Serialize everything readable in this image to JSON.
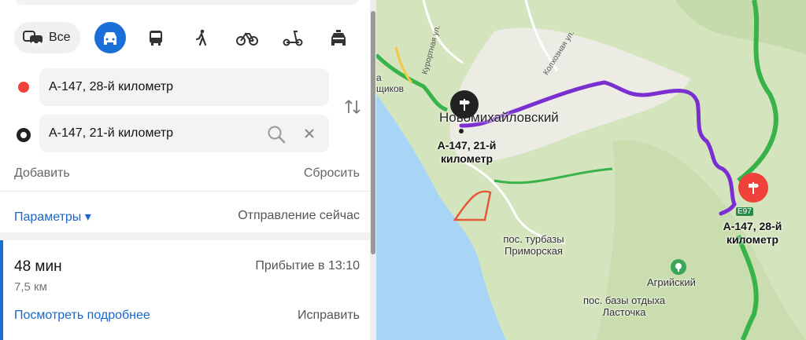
{
  "modes": {
    "all_label": "Все",
    "items": [
      {
        "name": "car",
        "active": true
      },
      {
        "name": "bus"
      },
      {
        "name": "walk"
      },
      {
        "name": "bicycle"
      },
      {
        "name": "scooter"
      },
      {
        "name": "taxi"
      }
    ]
  },
  "route_points": {
    "from": "А-147, 28-й километр",
    "to": "А-147, 21-й километр"
  },
  "actions": {
    "add": "Добавить",
    "reset": "Сбросить"
  },
  "params": {
    "label": "Параметры ▾",
    "departure": "Отправление сейчас"
  },
  "route": {
    "duration": "48 мин",
    "distance": "7,5 км",
    "arrival": "Прибытие в 13:10",
    "details": "Посмотреть подробнее",
    "fix": "Исправить"
  },
  "map": {
    "city": "Новомихайловский",
    "start_label": "А-147, 21-й километр",
    "end_label": "А-147, 28-й километр",
    "highway_badge": "E97",
    "place_primorskaya": "пос. турбазы Приморская",
    "place_agriysky": "Агрийский",
    "place_lastochka": "пос. базы отдыха Ласточка",
    "street_kurortnaya": "Курортная ул.",
    "street_kolkhoznaya": "Колхозная ул.",
    "fragment_a": "а",
    "fragment_shchikov": "щиков"
  },
  "colors": {
    "accent": "#1a6fd8",
    "route": "#7b2fd0",
    "road_green": "#37b34a",
    "sea": "#a8d4f5",
    "pin_red": "#f0413a"
  }
}
